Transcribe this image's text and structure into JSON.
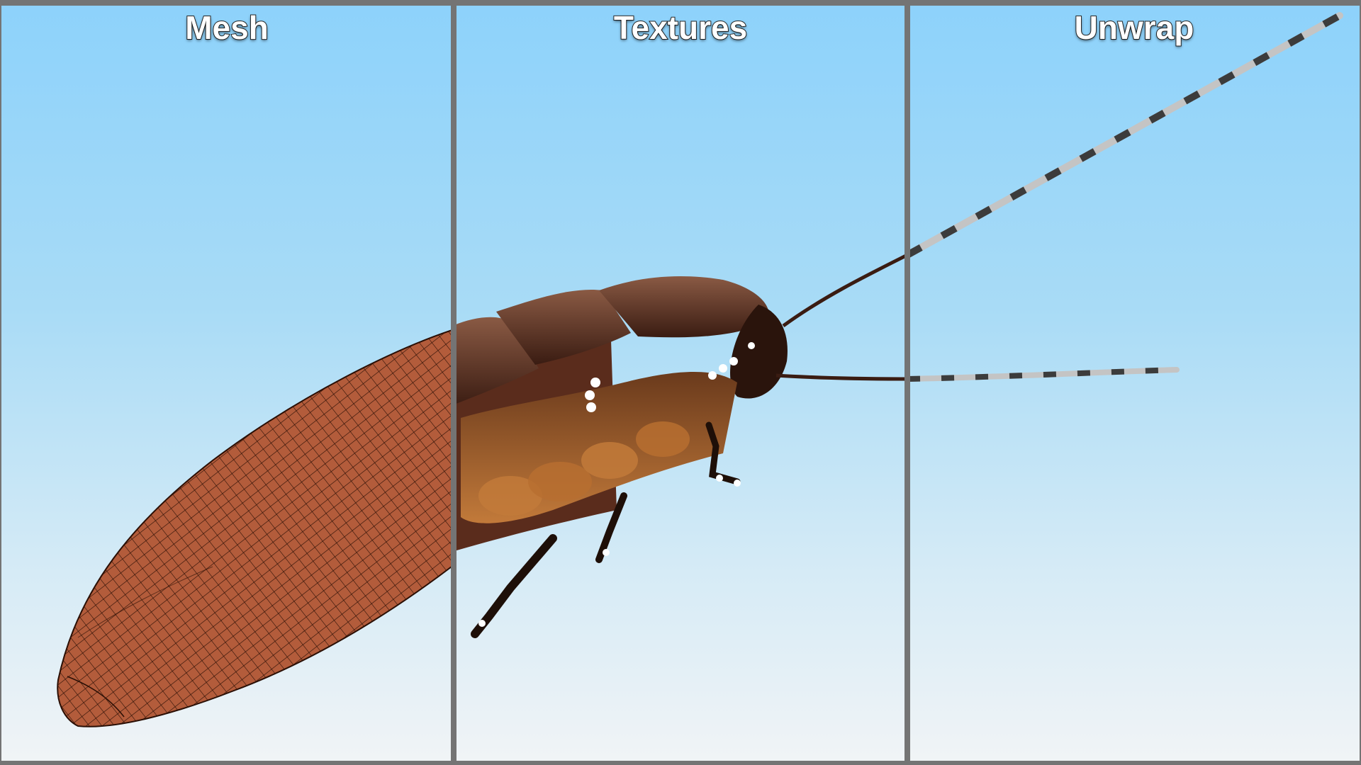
{
  "panels": [
    {
      "label": "Mesh"
    },
    {
      "label": "Textures"
    },
    {
      "label": "Unwrap"
    }
  ],
  "colors": {
    "background_top": "#8dd2fb",
    "background_bottom": "#f1f4f6",
    "divider": "#747474",
    "mesh_fill": "#b35c3b",
    "mesh_wire": "#2a0f05",
    "shell_dark": "#4a2618",
    "shell_light": "#8a5a44",
    "belly": "#a8672c",
    "antenna_dark": "#3c3c3c",
    "antenna_light": "#c4c4c4"
  },
  "icons": [
    "cockroach-mesh-render",
    "cockroach-textured-render",
    "antenna-uv-render"
  ]
}
